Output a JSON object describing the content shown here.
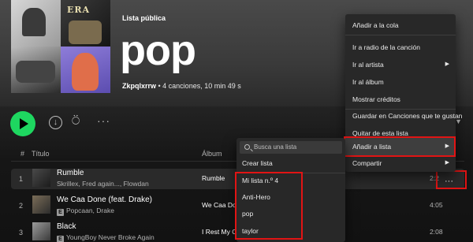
{
  "playlist": {
    "type_label": "Lista pública",
    "title": "pop",
    "owner": "Zkpqlxrrw",
    "meta": " • 4 canciones, 10 min 49 s",
    "cover_text": "ERA"
  },
  "actions": {
    "download_icon": "↓",
    "follow_icon": "⍥",
    "more_icon": "···"
  },
  "table": {
    "header_num": "#",
    "header_title": "Título",
    "header_album": "Álbum",
    "rows": [
      {
        "num": "1",
        "name": "Rumble",
        "artist": "Skrillex, Fred again..., Flowdan",
        "album": "Rumble",
        "duration": "2:2",
        "explicit": false
      },
      {
        "num": "2",
        "name": "We Caa Done (feat. Drake)",
        "artist": "Popcaan, Drake",
        "album": "We Caa Do",
        "duration": "4:05",
        "explicit": true
      },
      {
        "num": "3",
        "name": "Black",
        "artist": "YoungBoy Never Broke Again",
        "album": "I Rest My C",
        "duration": "2:08",
        "explicit": true
      }
    ],
    "explicit_label": "E",
    "row_more": "···"
  },
  "context_menu": {
    "items": [
      {
        "label": "Añadir a la cola",
        "arrow": ""
      },
      {
        "label": "Ir a radio de la canción",
        "arrow": ""
      },
      {
        "label": "Ir al artista",
        "arrow": "▶"
      },
      {
        "label": "Ir al álbum",
        "arrow": ""
      },
      {
        "label": "Mostrar créditos",
        "arrow": ""
      },
      {
        "label": "Guardar en Canciones que te gustan",
        "arrow": ""
      },
      {
        "label": "Quitar de esta lista",
        "arrow": ""
      },
      {
        "label": "Añadir a lista",
        "arrow": "▶"
      },
      {
        "label": "Compartir",
        "arrow": "▶"
      }
    ]
  },
  "submenu": {
    "search_placeholder": "Busca una lista",
    "create_label": "Crear lista",
    "lists": [
      "Mi lista n.º 4",
      "Anti-Hero",
      "pop",
      "taylor"
    ]
  },
  "colors": {
    "accent": "#1ed760",
    "highlight_box": "#e11414"
  }
}
